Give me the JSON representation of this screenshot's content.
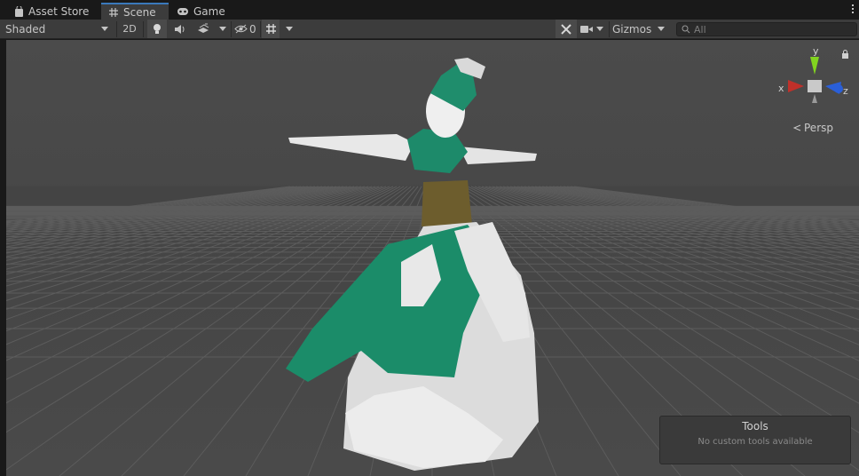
{
  "tabs": [
    {
      "label": "Asset Store",
      "icon": "bag-icon"
    },
    {
      "label": "Scene",
      "icon": "grid-icon",
      "active": true
    },
    {
      "label": "Game",
      "icon": "gamepad-icon"
    }
  ],
  "toolbar": {
    "shading_mode": "Shaded",
    "mode_2d": "2D",
    "hidden_count": "0",
    "gizmos_label": "Gizmos",
    "search_placeholder": "All"
  },
  "gizmo": {
    "axis_x": "x",
    "axis_y": "y",
    "axis_z": "z",
    "projection": "Persp",
    "colors": {
      "x": "#c0302a",
      "y": "#82d41f",
      "z": "#2a5fd8"
    }
  },
  "overlay": {
    "title": "Tools",
    "message": "No custom tools available"
  },
  "accent": "#3a79bb"
}
